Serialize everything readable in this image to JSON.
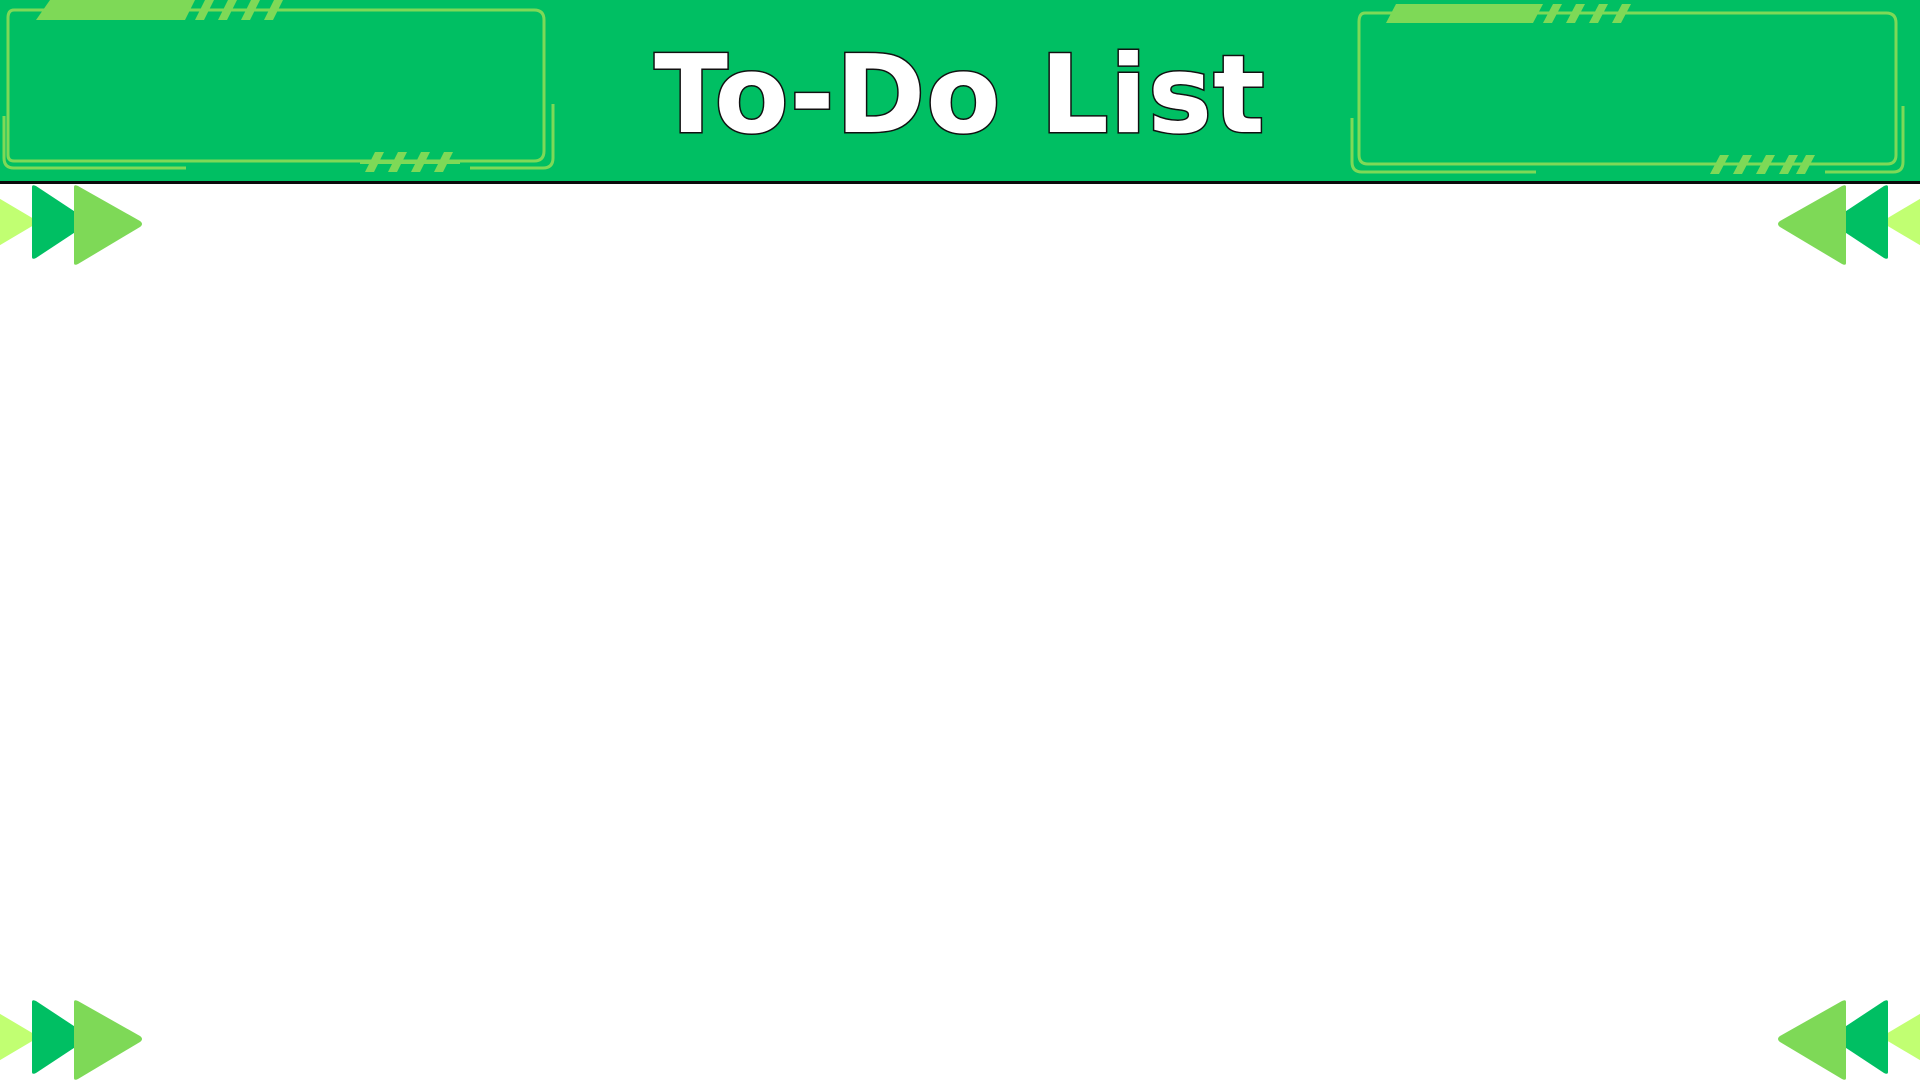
{
  "header": {
    "title": "To-Do List"
  },
  "colors": {
    "header_background": "#00bf63",
    "header_border": "#0a0a0a",
    "frame_line": "#7ed957",
    "triangle_light": "#c1ff72",
    "triangle_mid": "#7ed957",
    "triangle_dark": "#00bf63",
    "page_background": "#ffffff"
  },
  "icons": {
    "corner_decoration": "triangle-arrows-icon",
    "header_frame": "tech-frame-decoration"
  }
}
